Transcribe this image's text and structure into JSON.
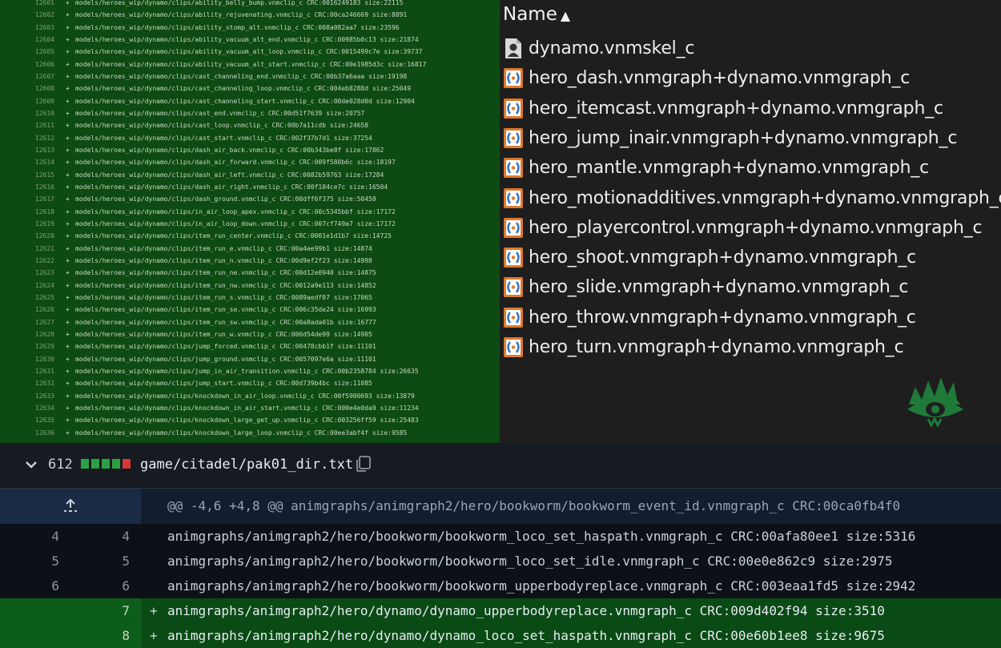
{
  "left_diff": {
    "rows": [
      {
        "line": "12601",
        "text": "models/heroes_wip/dynamo/clips/ability_belly_bump.vnmclip_c CRC:0016249183 size:22115"
      },
      {
        "line": "12602",
        "text": "models/heroes_wip/dynamo/clips/ability_rejuvenating.vnmclip_c CRC:00ca246669 size:8891"
      },
      {
        "line": "12603",
        "text": "models/heroes_wip/dynamo/clips/ability_stomp_alt.vnmclip_c CRC:008a082aa7 size:23596"
      },
      {
        "line": "12604",
        "text": "models/heroes_wip/dynamo/clips/ability_vacuum_alt_end.vnmclip_c CRC:00985b0c13 size:21874"
      },
      {
        "line": "12605",
        "text": "models/heroes_wip/dynamo/clips/ability_vacuum_alt_loop.vnmclip_c CRC:0015499c7e size:39737"
      },
      {
        "line": "12606",
        "text": "models/heroes_wip/dynamo/clips/ability_vacuum_alt_start.vnmclip_c CRC:00e1985d3c size:16817"
      },
      {
        "line": "12607",
        "text": "models/heroes_wip/dynamo/clips/cast_channeling_end.vnmclip_c CRC:00b37a6aaa size:19198"
      },
      {
        "line": "12608",
        "text": "models/heroes_wip/dynamo/clips/cast_channeling_loop.vnmclip_c CRC:004eb8288d size:25049"
      },
      {
        "line": "12609",
        "text": "models/heroes_wip/dynamo/clips/cast_channeling_start.vnmclip_c CRC:00de028d0d size:12904"
      },
      {
        "line": "12610",
        "text": "models/heroes_wip/dynamo/clips/cast_end.vnmclip_c CRC:00d51f7639 size:20757"
      },
      {
        "line": "12611",
        "text": "models/heroes_wip/dynamo/clips/cast_loop.vnmclip_c CRC:00b7a11cdb size:24658"
      },
      {
        "line": "12612",
        "text": "models/heroes_wip/dynamo/clips/cast_start.vnmclip_c CRC:002f37b7d1 size:37254"
      },
      {
        "line": "12613",
        "text": "models/heroes_wip/dynamo/clips/dash_air_back.vnmclip_c CRC:00b343be8f size:17862"
      },
      {
        "line": "12614",
        "text": "models/heroes_wip/dynamo/clips/dash_air_forward.vnmclip_c CRC:009f580b6c size:18197"
      },
      {
        "line": "12615",
        "text": "models/heroes_wip/dynamo/clips/dash_air_left.vnmclip_c CRC:0082b59763 size:17284"
      },
      {
        "line": "12616",
        "text": "models/heroes_wip/dynamo/clips/dash_air_right.vnmclip_c CRC:00f104ce7c size:16504"
      },
      {
        "line": "12617",
        "text": "models/heroes_wip/dynamo/clips/dash_ground.vnmclip_c CRC:00dff6f375 size:50450"
      },
      {
        "line": "12618",
        "text": "models/heroes_wip/dynamo/clips/in_air_loop_apex.vnmclip_c CRC:00c5345bbf size:17172"
      },
      {
        "line": "12619",
        "text": "models/heroes_wip/dynamo/clips/in_air_loop_down.vnmclip_c CRC:007cf749a7 size:17172"
      },
      {
        "line": "12620",
        "text": "models/heroes_wip/dynamo/clips/item_run_center.vnmclip_c CRC:0001e1d1b7 size:14725"
      },
      {
        "line": "12621",
        "text": "models/heroes_wip/dynamo/clips/item_run_e.vnmclip_c CRC:00a4ee99b1 size:14874"
      },
      {
        "line": "12622",
        "text": "models/heroes_wip/dynamo/clips/item_run_n.vnmclip_c CRC:00d9ef2f23 size:14998"
      },
      {
        "line": "12623",
        "text": "models/heroes_wip/dynamo/clips/item_run_ne.vnmclip_c CRC:00d12e0940 size:14875"
      },
      {
        "line": "12624",
        "text": "models/heroes_wip/dynamo/clips/item_run_nw.vnmclip_c CRC:0012a9e113 size:14852"
      },
      {
        "line": "12625",
        "text": "models/heroes_wip/dynamo/clips/item_run_s.vnmclip_c CRC:0089aedf07 size:17065"
      },
      {
        "line": "12626",
        "text": "models/heroes_wip/dynamo/clips/item_run_se.vnmclip_c CRC:006c35de24 size:16993"
      },
      {
        "line": "12627",
        "text": "models/heroes_wip/dynamo/clips/item_run_sw.vnmclip_c CRC:00a8ada01b size:16777"
      },
      {
        "line": "12628",
        "text": "models/heroes_wip/dynamo/clips/item_run_w.vnmclip_c CRC:006d54de99 size:14905"
      },
      {
        "line": "12629",
        "text": "models/heroes_wip/dynamo/clips/jump_forced.vnmclip_c CRC:00478cbb1f size:11101"
      },
      {
        "line": "12630",
        "text": "models/heroes_wip/dynamo/clips/jump_ground.vnmclip_c CRC:0057097e6a size:11101"
      },
      {
        "line": "12631",
        "text": "models/heroes_wip/dynamo/clips/jump_in_air_transition.vnmclip_c CRC:00b2358784 size:26635"
      },
      {
        "line": "12632",
        "text": "models/heroes_wip/dynamo/clips/jump_start.vnmclip_c CRC:00d739b4bc size:11085"
      },
      {
        "line": "12633",
        "text": "models/heroes_wip/dynamo/clips/knockdown_in_air_loop.vnmclip_c CRC:00f5900693 size:13879"
      },
      {
        "line": "12634",
        "text": "models/heroes_wip/dynamo/clips/knockdown_in_air_start.vnmclip_c CRC:000e4e0da9 size:11234"
      },
      {
        "line": "12635",
        "text": "models/heroes_wip/dynamo/clips/knockdown_large_get_up.vnmclip_c CRC:003256ff59 size:25483"
      },
      {
        "line": "12636",
        "text": "models/heroes_wip/dynamo/clips/knockdown_large_loop.vnmclip_c CRC:00ee3abf4f size:9585"
      }
    ]
  },
  "explorer": {
    "column_header": "Name",
    "sort_indicator": "▲",
    "files": [
      {
        "name": "dynamo.vnmskel_c",
        "icon": "skeleton-file-icon"
      },
      {
        "name": "hero_dash.vnmgraph+dynamo.vnmgraph_c",
        "icon": "graph-file-icon"
      },
      {
        "name": "hero_itemcast.vnmgraph+dynamo.vnmgraph_c",
        "icon": "graph-file-icon"
      },
      {
        "name": "hero_jump_inair.vnmgraph+dynamo.vnmgraph_c",
        "icon": "graph-file-icon"
      },
      {
        "name": "hero_mantle.vnmgraph+dynamo.vnmgraph_c",
        "icon": "graph-file-icon"
      },
      {
        "name": "hero_motionadditives.vnmgraph+dynamo.vnmgraph_c",
        "icon": "graph-file-icon"
      },
      {
        "name": "hero_playercontrol.vnmgraph+dynamo.vnmgraph_c",
        "icon": "graph-file-icon"
      },
      {
        "name": "hero_shoot.vnmgraph+dynamo.vnmgraph_c",
        "icon": "graph-file-icon"
      },
      {
        "name": "hero_slide.vnmgraph+dynamo.vnmgraph_c",
        "icon": "graph-file-icon"
      },
      {
        "name": "hero_throw.vnmgraph+dynamo.vnmgraph_c",
        "icon": "graph-file-icon"
      },
      {
        "name": "hero_turn.vnmgraph+dynamo.vnmgraph_c",
        "icon": "graph-file-icon"
      }
    ],
    "watermark_icon": "eye-crown-logo-icon"
  },
  "github_diff": {
    "file_header": {
      "changes": "612",
      "path": "game/citadel/pak01_dir.txt",
      "blocks": [
        "#2ea043",
        "#2ea043",
        "#2ea043",
        "#2ea043",
        "#da3633"
      ]
    },
    "hunk_header": "@@ -4,6 +4,8 @@ animgraphs/animgraph2/hero/bookworm/bookworm_event_id.vnmgraph_c CRC:00ca0fb4f0",
    "rows": [
      {
        "type": "ctx",
        "old": "4",
        "new": "4",
        "marker": "",
        "code": "animgraphs/animgraph2/hero/bookworm/bookworm_loco_set_haspath.vnmgraph_c CRC:00afa80ee1 size:5316"
      },
      {
        "type": "ctx",
        "old": "5",
        "new": "5",
        "marker": "",
        "code": "animgraphs/animgraph2/hero/bookworm/bookworm_loco_set_idle.vnmgraph_c CRC:00e0e862c9 size:2975"
      },
      {
        "type": "ctx",
        "old": "6",
        "new": "6",
        "marker": "",
        "code": "animgraphs/animgraph2/hero/bookworm/bookworm_upperbodyreplace.vnmgraph_c CRC:003eaa1fd5 size:2942"
      },
      {
        "type": "add",
        "old": "",
        "new": "7",
        "marker": "+",
        "code": "animgraphs/animgraph2/hero/dynamo/dynamo_upperbodyreplace.vnmgraph_c CRC:009d402f94 size:3510"
      },
      {
        "type": "add",
        "old": "",
        "new": "8",
        "marker": "+",
        "code": "animgraphs/animgraph2/hero/dynamo/dynamo_loco_set_haspath.vnmgraph_c CRC:00e60b1ee8 size:9675"
      }
    ]
  }
}
